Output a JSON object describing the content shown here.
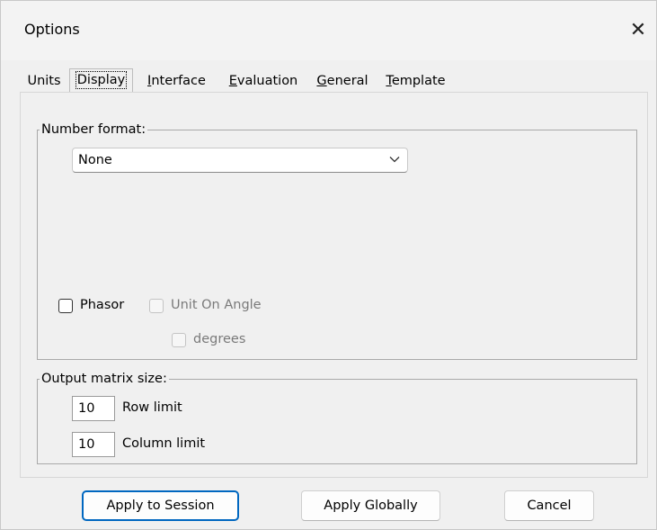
{
  "window": {
    "title": "Options",
    "close_glyph": "✕"
  },
  "tabs": [
    {
      "label": "Units",
      "mnemonic_index": -1
    },
    {
      "label": "Display",
      "mnemonic_index": 0,
      "active": true
    },
    {
      "label": "Interface",
      "mnemonic_index": 0
    },
    {
      "label": "Evaluation",
      "mnemonic_index": 0
    },
    {
      "label": "General",
      "mnemonic_index": 0
    },
    {
      "label": "Template",
      "mnemonic_index": 0
    }
  ],
  "number_format": {
    "legend": "Number format:",
    "selected": "None",
    "phasor": {
      "label": "Phasor",
      "checked": false,
      "enabled": true
    },
    "unit_on_angle": {
      "label": "Unit On Angle",
      "checked": false,
      "enabled": false
    },
    "degrees": {
      "label": "degrees",
      "checked": false,
      "enabled": false
    }
  },
  "output_matrix": {
    "legend": "Output matrix size:",
    "row_limit_value": "10",
    "row_limit_label": "Row limit",
    "column_limit_value": "10",
    "column_limit_label": "Column limit"
  },
  "buttons": {
    "apply_session": "Apply to Session",
    "apply_globally": "Apply Globally",
    "cancel": "Cancel"
  },
  "colors": {
    "accent": "#0067c0",
    "dialog_bg": "#f0f0f0"
  }
}
